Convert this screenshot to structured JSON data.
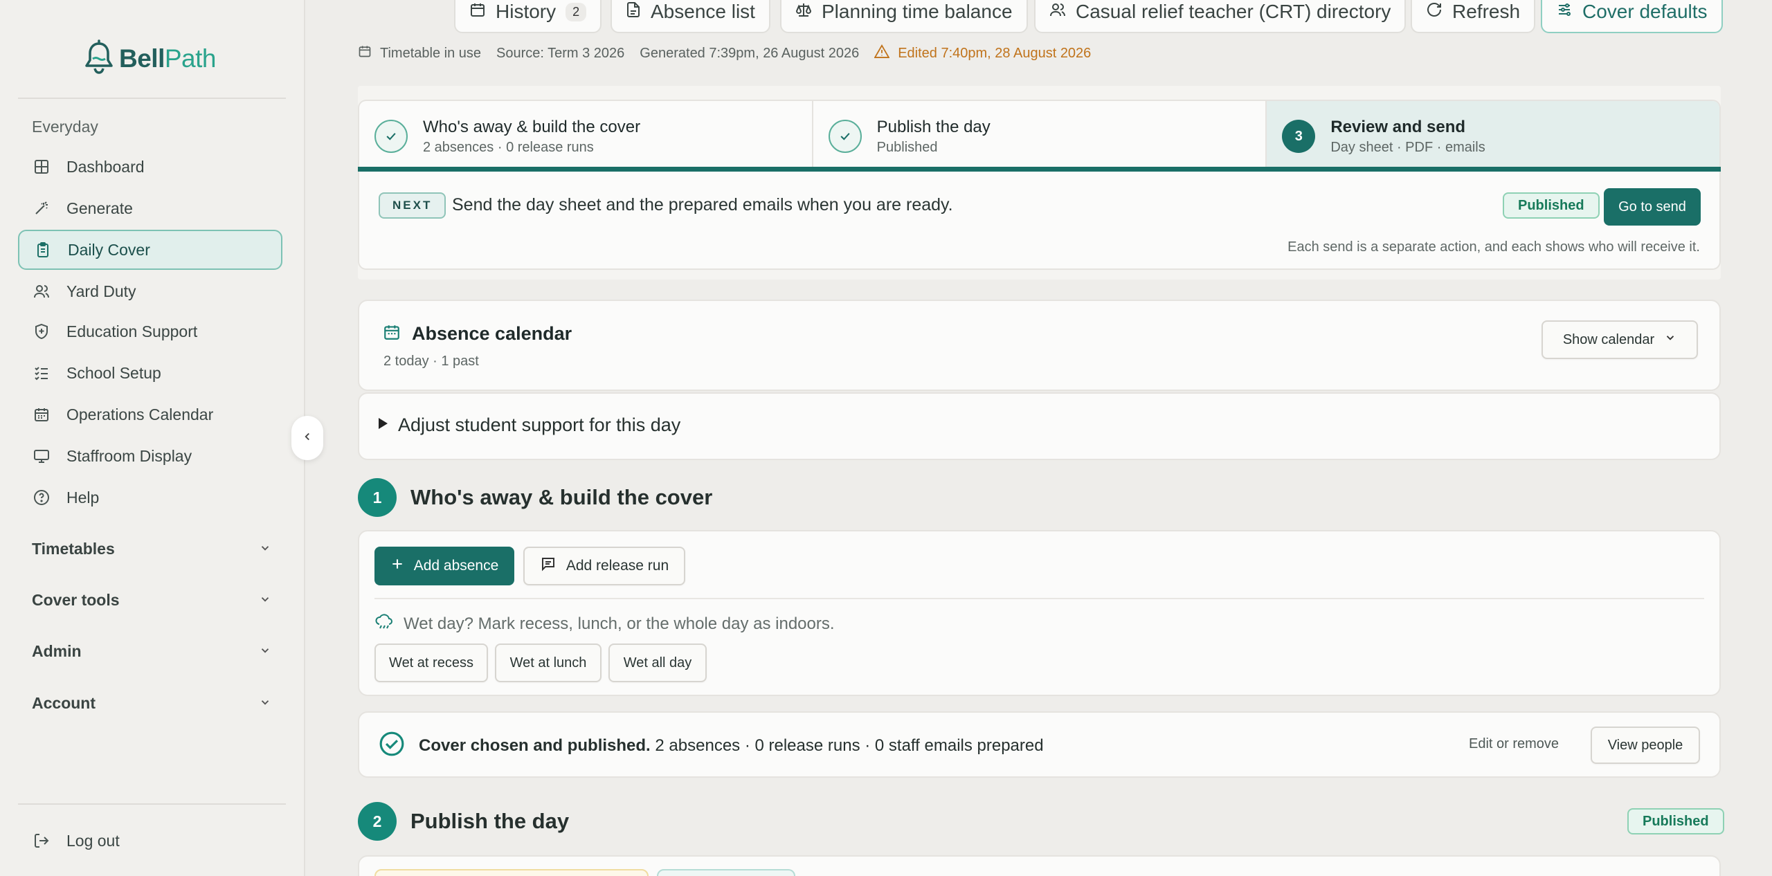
{
  "brand": {
    "name_a": "Bell",
    "name_b": "Path"
  },
  "sidebar": {
    "section": "Everyday",
    "items": [
      {
        "label": "Dashboard",
        "icon": "grid-icon"
      },
      {
        "label": "Generate",
        "icon": "wand-icon"
      },
      {
        "label": "Daily Cover",
        "icon": "clipboard-icon",
        "active": true
      },
      {
        "label": "Yard Duty",
        "icon": "users-icon"
      },
      {
        "label": "Education Support",
        "icon": "shield-plus-icon"
      },
      {
        "label": "School Setup",
        "icon": "checklist-icon"
      },
      {
        "label": "Operations Calendar",
        "icon": "calendar-icon"
      },
      {
        "label": "Staffroom Display",
        "icon": "monitor-icon"
      },
      {
        "label": "Help",
        "icon": "help-circle-icon"
      }
    ],
    "groups": [
      "Timetables",
      "Cover tools",
      "Admin",
      "Account"
    ],
    "logout": "Log out"
  },
  "toolbar": {
    "history": "History",
    "history_count": "2",
    "absence_list": "Absence list",
    "planning": "Planning time balance",
    "crt": "Casual relief teacher (CRT) directory",
    "refresh": "Refresh",
    "cover_defaults": "Cover defaults"
  },
  "meta": {
    "timetable": "Timetable in use",
    "source": "Source: Term 3 2026",
    "generated": "Generated 7:39pm, 26 August 2026",
    "edited": "Edited 7:40pm, 28 August 2026"
  },
  "steps": [
    {
      "title": "Who's away & build the cover",
      "sub": "2 absences · 0 release runs",
      "state": "done"
    },
    {
      "title": "Publish the day",
      "sub": "Published",
      "state": "done"
    },
    {
      "num": "3",
      "title": "Review and send",
      "sub": "Day sheet · PDF · emails",
      "state": "current"
    }
  ],
  "next": {
    "tag": "NEXT",
    "text": "Send the day sheet and the prepared emails when you are ready.",
    "status": "Published",
    "button": "Go to send",
    "note": "Each send is a separate action, and each shows who will receive it."
  },
  "calendar": {
    "title": "Absence calendar",
    "sub": "2 today · 1 past",
    "button": "Show calendar"
  },
  "support": {
    "label": "Adjust student support for this day"
  },
  "section1": {
    "num": "1",
    "title": "Who's away & build the cover",
    "add_absence": "Add absence",
    "add_release": "Add release run",
    "wet_prompt": "Wet day? Mark recess, lunch, or the whole day as indoors.",
    "wet_buttons": [
      "Wet at recess",
      "Wet at lunch",
      "Wet all day"
    ]
  },
  "summary": {
    "bold": "Cover chosen and published.",
    "rest": "2 absences · 0 release runs · 0 staff emails prepared",
    "edit": "Edit or remove",
    "view": "View people"
  },
  "section2": {
    "num": "2",
    "title": "Publish the day",
    "status": "Published"
  },
  "colors": {
    "accent": "#1a6f67",
    "published": "#177a5a",
    "warning": "#c0731b"
  }
}
